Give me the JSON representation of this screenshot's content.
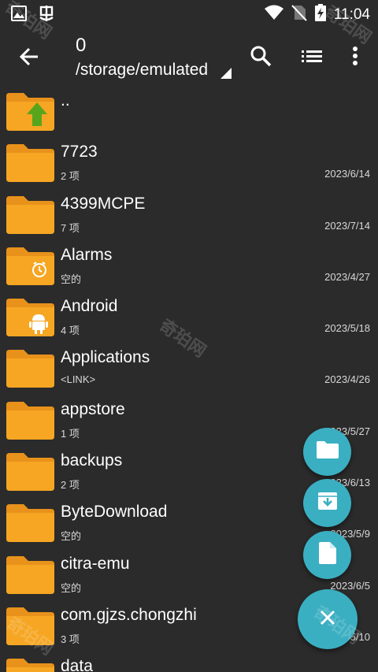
{
  "status_bar": {
    "time": "11:04",
    "left_icons": [
      "image-icon",
      "bug-icon"
    ],
    "right_icons": [
      "wifi-icon",
      "no-sim-icon",
      "battery-charging-icon"
    ]
  },
  "toolbar": {
    "selected_count": "0",
    "path": "/storage/emulated",
    "icons": [
      "back-arrow-icon",
      "search-icon",
      "list-view-icon",
      "more-vert-icon"
    ]
  },
  "files": [
    {
      "name": "..",
      "sub": "",
      "date": "",
      "badge": "up-arrow"
    },
    {
      "name": "7723",
      "sub": "2 项",
      "date": "2023/6/14",
      "badge": ""
    },
    {
      "name": "4399MCPE",
      "sub": "7 项",
      "date": "2023/7/14",
      "badge": ""
    },
    {
      "name": "Alarms",
      "sub": "空的",
      "date": "2023/4/27",
      "badge": "alarm"
    },
    {
      "name": "Android",
      "sub": "4 项",
      "date": "2023/5/18",
      "badge": "android"
    },
    {
      "name": "Applications",
      "sub": "<LINK>",
      "date": "2023/4/26",
      "badge": ""
    },
    {
      "name": "appstore",
      "sub": "1 项",
      "date": "2023/5/27",
      "badge": ""
    },
    {
      "name": "backups",
      "sub": "2 项",
      "date": "2023/6/13",
      "badge": ""
    },
    {
      "name": "ByteDownload",
      "sub": "空的",
      "date": "2023/5/9",
      "badge": ""
    },
    {
      "name": "citra-emu",
      "sub": "空的",
      "date": "2023/6/5",
      "badge": ""
    },
    {
      "name": "com.gjzs.chongzhi",
      "sub": "3 项",
      "date": "2023/5/10",
      "badge": ""
    },
    {
      "name": "data",
      "sub": "",
      "date": "",
      "badge": ""
    }
  ],
  "fab": {
    "items": [
      "new-folder-icon",
      "archive-icon",
      "new-file-icon"
    ],
    "main": "close-icon"
  },
  "colors": {
    "background": "#2b2b2b",
    "folder": "#f6a623",
    "folder_tab": "#e8921b",
    "fab": "#3aafc1"
  },
  "watermark": "奇珀网"
}
